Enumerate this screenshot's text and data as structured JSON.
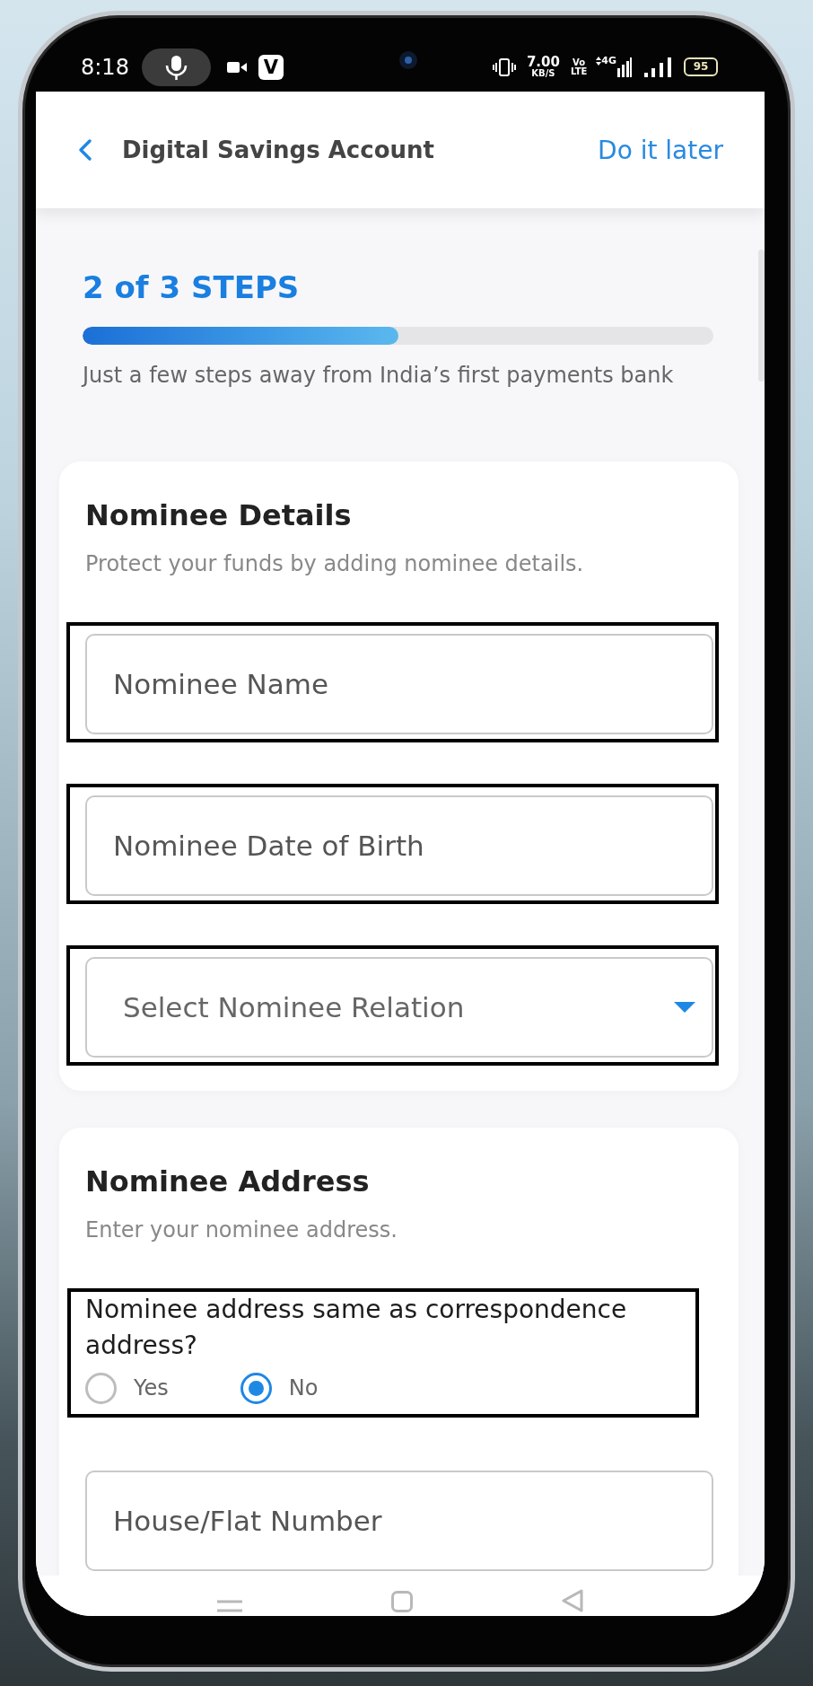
{
  "status_bar": {
    "time": "8:18",
    "app_badge": "V",
    "speed": "7.00",
    "speed_unit": "KB/S",
    "volte_top": "Vo",
    "volte_bottom": "LTE",
    "network": "4G",
    "battery": "95"
  },
  "header": {
    "title": "Digital Savings Account",
    "action": "Do it later"
  },
  "progress": {
    "label": "2 of 3 STEPS",
    "level": 0.5,
    "caption": "Just a few steps away from India’s first payments bank"
  },
  "sections": [
    {
      "title": "Nominee Details",
      "description": "Protect your funds by adding nominee details.",
      "fields": [
        {
          "kind": "input",
          "placeholder": "Nominee Name",
          "highlighted": true
        },
        {
          "kind": "input",
          "placeholder": "Nominee Date of Birth",
          "highlighted": true
        },
        {
          "kind": "select",
          "placeholder": "Select Nominee Relation",
          "highlighted": true
        }
      ]
    },
    {
      "title": "Nominee Address",
      "description": "Enter your nominee address.",
      "fields": [
        {
          "kind": "radio",
          "question": "Nominee address same as correspondence address?",
          "highlighted": true,
          "options": [
            {
              "label": "Yes",
              "selected": false
            },
            {
              "label": "No",
              "selected": true
            }
          ]
        },
        {
          "kind": "input",
          "placeholder": "House/Flat Number",
          "highlighted": false
        }
      ]
    }
  ]
}
